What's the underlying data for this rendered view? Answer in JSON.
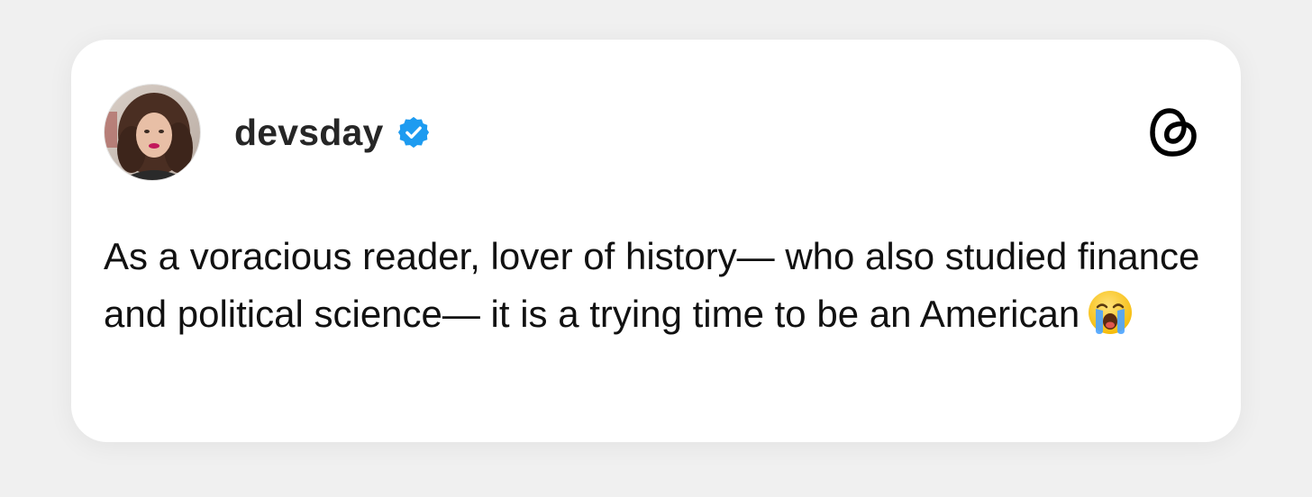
{
  "post": {
    "username": "devsday",
    "verified": true,
    "text": "As a voracious reader, lover of history— who also studied finance and political science— it is a trying time to be an American",
    "emoji": "loudly-crying-face"
  },
  "icons": {
    "verified_badge": "verified-badge-icon",
    "platform_logo": "threads-logo-icon"
  },
  "colors": {
    "background": "#f0f0f0",
    "card": "#ffffff",
    "username": "#262626",
    "text": "#111111",
    "verified_blue": "#1d9bf0"
  }
}
